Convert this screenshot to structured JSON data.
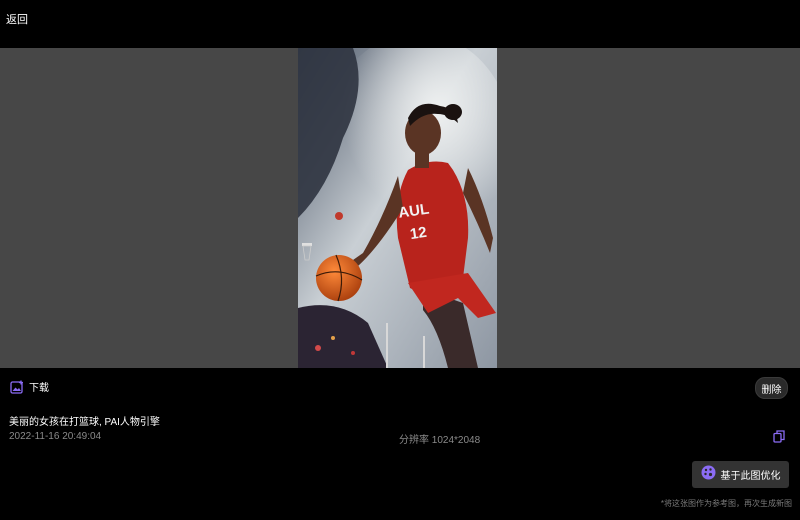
{
  "topbar": {
    "back_label": "返回"
  },
  "actions": {
    "download_label": "下载",
    "delete_label": "删除",
    "prompt_text": "美丽的女孩在打篮球, PAI人物引擎",
    "timestamp": "2022-11-16 20:49:04",
    "resolution": "分辨率 1024*2048",
    "optimize_label": "基于此图优化",
    "footnote": "*将这张图作为参考图，再次生成新图"
  },
  "colors": {
    "accent": "#8b6cf5",
    "stage_bg": "#474747",
    "muted_text": "#8a8a8a"
  },
  "icons": {
    "download": "image-download-icon",
    "copy": "copy-icon",
    "optimize": "palette-icon"
  }
}
